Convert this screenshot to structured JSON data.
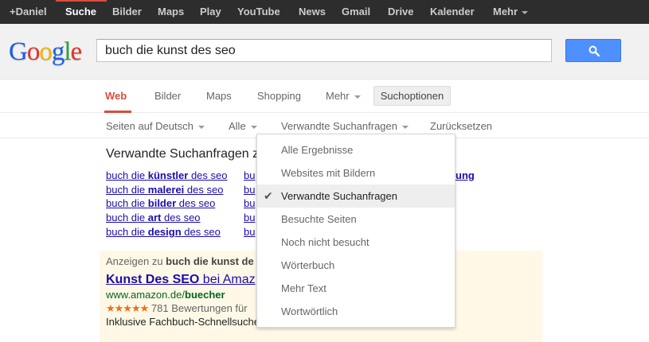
{
  "gbar": {
    "items": [
      "+Daniel",
      "Suche",
      "Bilder",
      "Maps",
      "Play",
      "YouTube",
      "News",
      "Gmail",
      "Drive",
      "Kalender",
      "Mehr"
    ]
  },
  "logo": {
    "letters": [
      "G",
      "o",
      "o",
      "g",
      "l",
      "e"
    ],
    "colors": [
      "#1c5ee8",
      "#e6302a",
      "#f5b400",
      "#1c5ee8",
      "#2aa33a",
      "#e6302a"
    ]
  },
  "search": {
    "value": "buch die kunst des seo",
    "button_icon": "search-icon"
  },
  "nav": {
    "tabs": [
      "Web",
      "Bilder",
      "Maps",
      "Shopping",
      "Mehr"
    ],
    "options_button": "Suchoptionen"
  },
  "tools": [
    "Seiten auf Deutsch",
    "Alle",
    "Verwandte Suchanfragen",
    "Zurücksetzen"
  ],
  "related": {
    "title": "Verwandte Suchanfragen zu",
    "col1": [
      {
        "pre": "buch die ",
        "bold": "künstler",
        "post": " des seo"
      },
      {
        "pre": "buch die ",
        "bold": "malerei",
        "post": " des seo"
      },
      {
        "pre": "buch die ",
        "bold": "bilder",
        "post": " des seo"
      },
      {
        "pre": "buch die ",
        "bold": "art",
        "post": " des seo"
      },
      {
        "pre": "buch die ",
        "bold": "design",
        "post": " des seo"
      }
    ],
    "col2_fragments": [
      "bu",
      "bu",
      "bu",
      "bu",
      "bu"
    ],
    "col2_tail": "ung"
  },
  "ads": {
    "heading_pre": "Anzeigen zu ",
    "heading_bold": "buch die kunst de",
    "title_bold": "Kunst Des SEO",
    "title_rest": " bei Amaz",
    "url_pre": "www.amazon.de/",
    "url_bold": "buecher",
    "stars": "★★★★★",
    "rating": " 781 Bewertungen für",
    "desc": "Inklusive Fachbuch-Schnellsuche"
  },
  "menu": {
    "items": [
      "Alle Ergebnisse",
      "Websites mit Bildern",
      "Verwandte Suchanfragen",
      "Besuchte Seiten",
      "Noch nicht besucht",
      "Wörterbuch",
      "Mehr Text",
      "Wortwörtlich"
    ],
    "selected_index": 2,
    "check_glyph": "✔"
  }
}
